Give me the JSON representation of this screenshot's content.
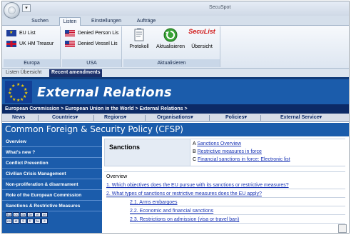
{
  "window": {
    "title": "SecuSpot"
  },
  "ribbon": {
    "tabs": [
      "Suchen",
      "Listen",
      "Einstellungen",
      "Aufträge"
    ],
    "active_tab": "Listen",
    "groups": [
      {
        "label": "Europa",
        "items": [
          "EU List",
          "UK HM Treasur"
        ]
      },
      {
        "label": "USA",
        "items": [
          "Denied Person Lis",
          "Denied Vessel Lis"
        ]
      },
      {
        "label": "Aktualisieren",
        "items": [
          "Protokoll",
          "Aktualisieren",
          "Übersicht"
        ],
        "brand_text": "SecuList"
      }
    ]
  },
  "subtabs": [
    "Listen Übersicht",
    "Recent amendments"
  ],
  "active_subtab": "Recent amendments",
  "page": {
    "banner_title": "External Relations",
    "breadcrumb": "European Commission > European Union in the World > External Relations >",
    "menu": [
      "News",
      "Countries▾",
      "Regions▾",
      "Organisations▾",
      "Policies▾",
      "External Service▾"
    ],
    "section_title": "Common Foreign & Security Policy (CFSP)",
    "left_nav": [
      "Overview",
      "What's new ?",
      "Conflict Prevention",
      "Civilian Crisis Management",
      "Non-proliferation & disarmament",
      "Role of the European Commission",
      "Sanctions & Restrictive Measures"
    ],
    "languages_row1": [
      "bg",
      "cs",
      "da",
      "de",
      "el",
      "en"
    ],
    "languages_row2": [
      "es",
      "et",
      "fi",
      "fr",
      "hu",
      "it"
    ],
    "sanctions": {
      "title": "Sanctions",
      "toc": [
        {
          "letter": "A",
          "text": "Sanctions Overview"
        },
        {
          "letter": "B",
          "text": "Restrictive measures in force"
        },
        {
          "letter": "C",
          "text": "Financial sanctions in force: Electronic list"
        }
      ]
    },
    "overview_label": "Overview",
    "overview_items": [
      "1. Which objectives does the EU pursue with its sanctions or restrictive measures?",
      "2. What types of sanctions or restrictive measures does the EU apply?",
      "2.1. Arms embargoes",
      "2.2. Economic and financial sanctions",
      "2.3. Restrictions on admission (visa or travel ban)"
    ]
  },
  "colors": {
    "banner": "#1b5cab",
    "breadcrumb": "#0c2a66",
    "link": "#1a35b5",
    "ribbon": "#dde6f1"
  }
}
